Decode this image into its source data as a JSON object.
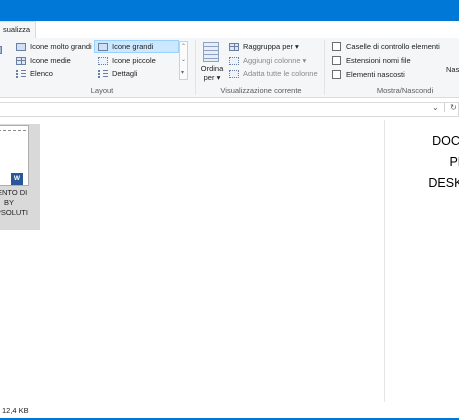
{
  "ribbon": {
    "active_tab": "sualizza",
    "layout": {
      "label": "Layout",
      "items": [
        "Icone molto grandi",
        "Icone grandi",
        "Icone medie",
        "Icone piccole",
        "Elenco",
        "Dettagli"
      ],
      "selected": "Icone grandi",
      "scroll_glyphs": [
        "⌃",
        "⌄",
        "▾"
      ]
    },
    "current_view": {
      "label": "Visualizzazione corrente",
      "sort_label_1": "Ordina",
      "sort_label_2": "per",
      "sort_arrow": "▾",
      "group_by": "Raggruppa per",
      "group_by_arrow": "▾",
      "add_columns": "Aggiungi colonne",
      "add_columns_arrow": "▾",
      "fit_columns": "Adatta tutte le colonne"
    },
    "show_hide": {
      "label": "Mostra/Nascondi",
      "item_checkboxes": "Caselle di controllo elementi",
      "file_extensions": "Estensioni nomi file",
      "hidden_items": "Elementi nascosti",
      "hide_partial": "Nas"
    }
  },
  "address": {
    "chevron": "⌄",
    "refresh": "↻"
  },
  "files": [
    {
      "name_lines": [
        "MENTO DI",
        "BY",
        "OPSOLUTI"
      ],
      "badge": "W",
      "icon": "word-document-icon"
    }
  ],
  "preview": {
    "lines": [
      "DOCUN",
      "PRO",
      "DESKTO"
    ]
  },
  "status": {
    "size": "12,4 KB"
  },
  "colors": {
    "accent": "#0078d7",
    "selection": "#cce8ff",
    "word_blue": "#2b579a"
  }
}
